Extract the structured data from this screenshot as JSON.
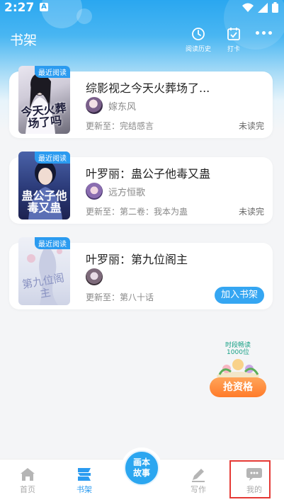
{
  "status_bar": {
    "time": "2:27",
    "app_badge": "A"
  },
  "header": {
    "title": "书架",
    "history_label": "阅读历史",
    "checkin_label": "打卡"
  },
  "books": [
    {
      "badge": "最近阅读",
      "cover_text": "今天火葬场了吗",
      "title": "综影视之今天火葬场了...",
      "author": "嫁东风",
      "update": "更新至：完结感言",
      "status": "未读完"
    },
    {
      "badge": "最近阅读",
      "cover_text": "蛊公子他毒又蛊",
      "title": "叶罗丽：蛊公子他毒又蛊",
      "author": "远方恒歌",
      "update": "更新至：第二卷：我本为蛊",
      "status": "未读完"
    },
    {
      "badge": "最近阅读",
      "cover_text": "第九位阁主",
      "title": "叶罗丽：第九位阁主",
      "author": "",
      "update": "更新至：第八十话",
      "action": "加入书架"
    }
  ],
  "promo": {
    "line1": "时段畅读",
    "line2": "1000位",
    "button": "抢资格"
  },
  "bottom_nav": {
    "home": "首页",
    "bookshelf": "书架",
    "center_line1": "画本",
    "center_line2": "故事",
    "write": "写作",
    "me": "我的"
  },
  "colors": {
    "accent": "#2b9bf0",
    "promo": "#ff7b2a",
    "highlight": "#e53935"
  }
}
